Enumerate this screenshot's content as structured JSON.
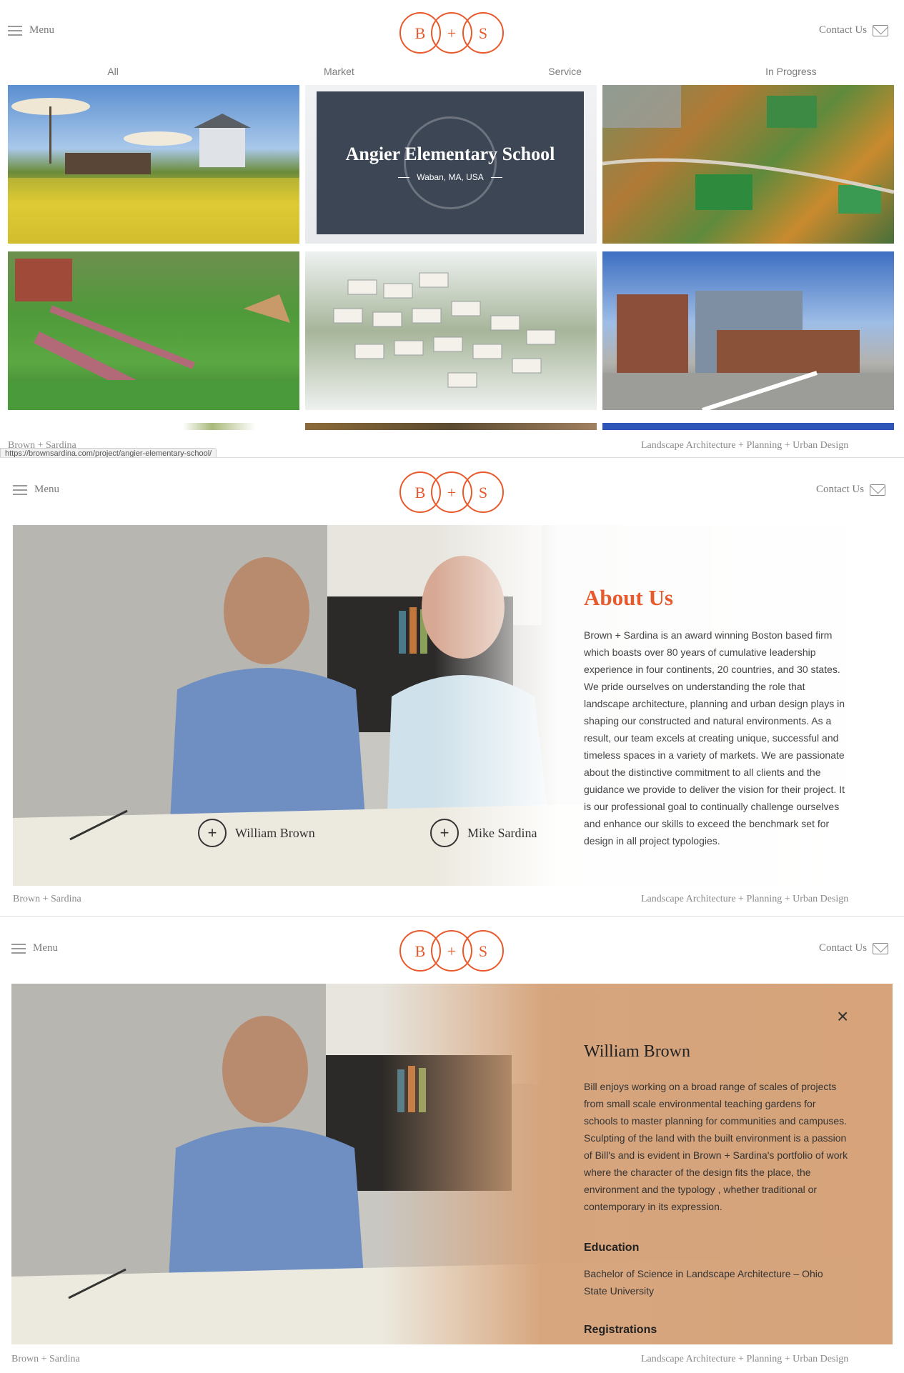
{
  "header": {
    "menu_label": "Menu",
    "contact_label": "Contact Us",
    "logo_letters": [
      "B",
      "+",
      "S"
    ],
    "accent_color": "#e8592b"
  },
  "filter_tabs": [
    "All",
    "Market",
    "Service",
    "In Progress"
  ],
  "projects": {
    "hover_card": {
      "title": "Angier Elementary School",
      "location": "Waban, MA, USA"
    }
  },
  "status_url": "https://brownsardina.com/project/angier-elementary-school/",
  "footer": {
    "left": "Brown + Sardina",
    "right": "Landscape Architecture + Planning + Urban Design"
  },
  "about": {
    "title": "About Us",
    "body": "Brown + Sardina is an award winning Boston based firm which boasts over 80 years of cumulative leadership experience in four continents, 20 countries, and 30 states. We pride ourselves on understanding the role that landscape architecture, planning and urban design plays in shaping our constructed and natural environments. As a result, our team excels at creating unique, successful and timeless spaces in a variety of markets. We are passionate about the distinctive commitment to all clients and the guidance we provide to deliver the vision for their project. It is our professional goal to continually challenge ourselves and enhance our skills to exceed the benchmark set for design in all project typologies.",
    "people": [
      "William Brown",
      "Mike Sardina"
    ]
  },
  "bio": {
    "name": "William Brown",
    "body": "Bill enjoys working on a broad range of scales of projects from small scale environmental teaching gardens for schools to master planning for communities and campuses.  Sculpting of the land with the built environment is a passion of Bill's and is evident in Brown + Sardina's portfolio of work where the character of the design fits the place, the environment and the typology , whether traditional or contemporary in its expression.",
    "education_heading": "Education",
    "education": "Bachelor of Science in Landscape Architecture – Ohio State University",
    "registrations_heading": "Registrations"
  }
}
